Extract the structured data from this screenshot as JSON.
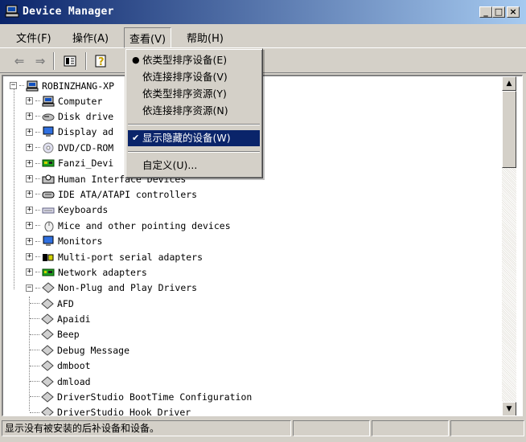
{
  "window": {
    "title": "Device Manager"
  },
  "menu": {
    "file": "文件(F)",
    "action": "操作(A)",
    "view": "查看(V)",
    "help": "帮助(H)"
  },
  "view_menu": {
    "items": [
      {
        "label": "依类型排序设备(E)",
        "mark": "●"
      },
      {
        "label": "依连接排序设备(V)",
        "mark": ""
      },
      {
        "label": "依类型排序资源(Y)",
        "mark": ""
      },
      {
        "label": "依连接排序资源(N)",
        "mark": ""
      },
      {
        "label": "显示隐藏的设备(W)",
        "mark": "✔"
      },
      {
        "label": "自定义(U)...",
        "mark": ""
      }
    ]
  },
  "tree": {
    "root": "ROBINZHANG-XP",
    "categories": [
      {
        "label": "Computer",
        "icon": "computer-icon"
      },
      {
        "label": "Disk drive",
        "icon": "disk-drive-icon"
      },
      {
        "label": "Display ad",
        "icon": "display-adapter-icon"
      },
      {
        "label": "DVD/CD-ROM",
        "icon": "dvd-icon"
      },
      {
        "label": "Fanzi_Devi",
        "icon": "board-icon"
      },
      {
        "label": "Human Interface Devices",
        "icon": "hid-icon"
      },
      {
        "label": "IDE ATA/ATAPI controllers",
        "icon": "ide-icon"
      },
      {
        "label": "Keyboards",
        "icon": "keyboard-icon"
      },
      {
        "label": "Mice and other pointing devices",
        "icon": "mouse-icon"
      },
      {
        "label": "Monitors",
        "icon": "monitor-icon"
      },
      {
        "label": "Multi-port serial adapters",
        "icon": "serial-icon"
      },
      {
        "label": "Network adapters",
        "icon": "network-icon"
      },
      {
        "label": "Non-Plug and Play Drivers",
        "icon": "driver-icon"
      }
    ],
    "drivers": [
      "AFD",
      "Apaidi",
      "Beep",
      "Debug Message",
      "dmboot",
      "dmload",
      "DriverStudio BootTime Configuration",
      "DriverStudio Hook Driver"
    ]
  },
  "statusbar": {
    "text": "显示没有被安装的后补设备和设备。"
  },
  "icons": {
    "back": "back-arrow-icon",
    "forward": "forward-arrow-icon",
    "properties": "properties-icon",
    "help": "help-icon"
  }
}
